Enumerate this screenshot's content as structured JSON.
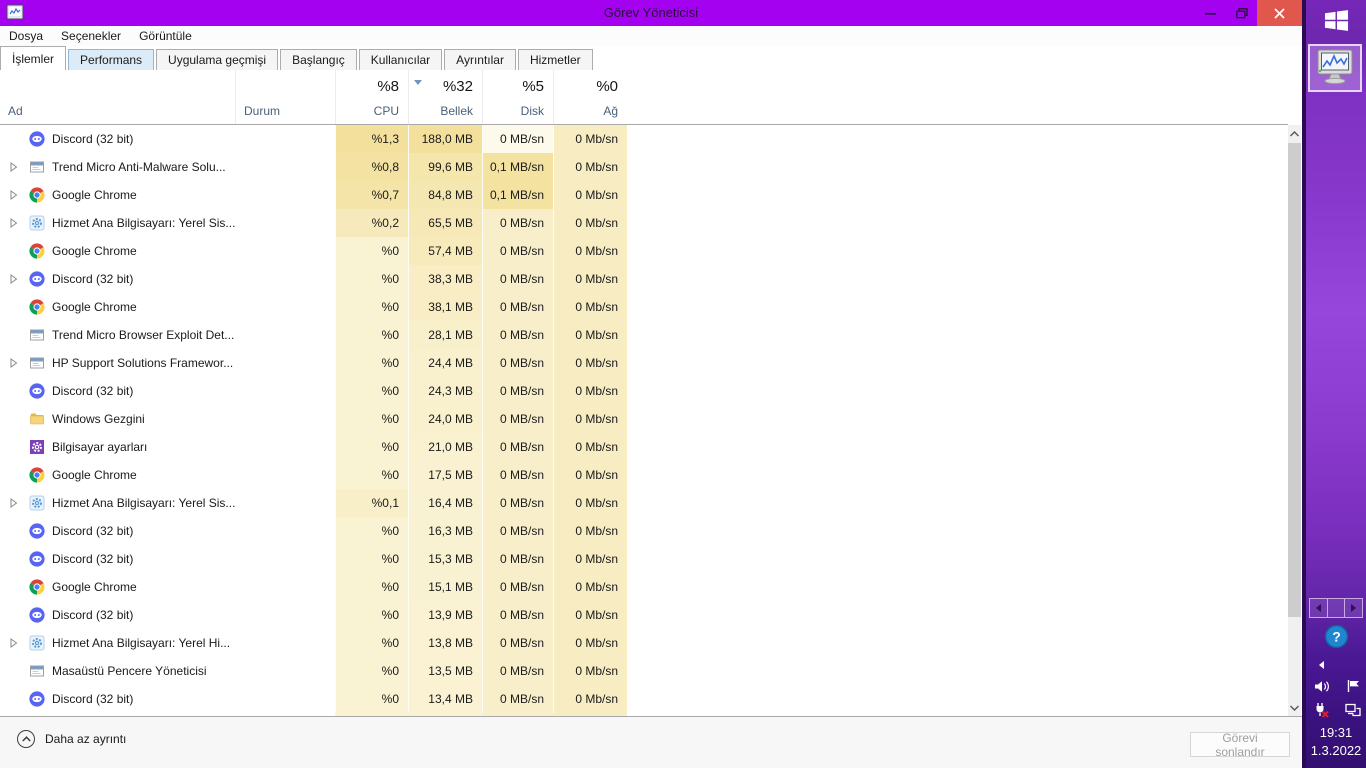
{
  "titlebar": {
    "title": "Görev Yöneticisi"
  },
  "menu": {
    "items": [
      "Dosya",
      "Seçenekler",
      "Görüntüle"
    ]
  },
  "tabs": [
    {
      "label": "İşlemler",
      "state": "selected"
    },
    {
      "label": "Performans",
      "state": "hover"
    },
    {
      "label": "Uygulama geçmişi",
      "state": "normal"
    },
    {
      "label": "Başlangıç",
      "state": "normal"
    },
    {
      "label": "Kullanıcılar",
      "state": "normal"
    },
    {
      "label": "Ayrıntılar",
      "state": "normal"
    },
    {
      "label": "Hizmetler",
      "state": "normal"
    }
  ],
  "header": {
    "name_label": "Ad",
    "status_label": "Durum",
    "cols": [
      {
        "key": "cpu",
        "label": "CPU",
        "total": "%8",
        "sorted": false
      },
      {
        "key": "mem",
        "label": "Bellek",
        "total": "%32",
        "sorted": true
      },
      {
        "key": "disk",
        "label": "Disk",
        "total": "%5",
        "sorted": false
      },
      {
        "key": "net",
        "label": "Ağ",
        "total": "%0",
        "sorted": false
      }
    ]
  },
  "rows": [
    {
      "icon": "discord",
      "name": "Discord (32 bit)",
      "expand": false,
      "status": "",
      "cpu": "%1,3",
      "mem": "188,0 MB",
      "disk": "0 MB/sn",
      "net": "0 Mb/sn",
      "heat": [
        "#f2e09c",
        "#f2e09c",
        "#fdfaeb",
        "#f7ecc2"
      ]
    },
    {
      "icon": "window",
      "name": "Trend Micro Anti-Malware Solu...",
      "expand": true,
      "status": "",
      "cpu": "%0,8",
      "mem": "99,6 MB",
      "disk": "0,1 MB/sn",
      "net": "0 Mb/sn",
      "heat": [
        "#f3e2a2",
        "#f5e6ac",
        "#f3e2a0",
        "#f7ecc2"
      ]
    },
    {
      "icon": "chrome",
      "name": "Google Chrome",
      "expand": true,
      "status": "",
      "cpu": "%0,7",
      "mem": "84,8 MB",
      "disk": "0,1 MB/sn",
      "net": "0 Mb/sn",
      "heat": [
        "#f4e4a7",
        "#f5e7b1",
        "#f3e2a0",
        "#f7ecc2"
      ]
    },
    {
      "icon": "servicehost",
      "name": "Hizmet Ana Bilgisayarı: Yerel Sis...",
      "expand": true,
      "status": "",
      "cpu": "%0,2",
      "mem": "65,5 MB",
      "disk": "0 MB/sn",
      "net": "0 Mb/sn",
      "heat": [
        "#f6eabc",
        "#f6e9b7",
        "#f8efca",
        "#f7ecc2"
      ]
    },
    {
      "icon": "chrome",
      "name": "Google Chrome",
      "expand": false,
      "status": "",
      "cpu": "%0",
      "mem": "57,4 MB",
      "disk": "0 MB/sn",
      "net": "0 Mb/sn",
      "heat": [
        "#f9f2d3",
        "#f7ebbb",
        "#f8efca",
        "#f7ecc2"
      ]
    },
    {
      "icon": "discord",
      "name": "Discord (32 bit)",
      "expand": true,
      "status": "",
      "cpu": "%0",
      "mem": "38,3 MB",
      "disk": "0 MB/sn",
      "net": "0 Mb/sn",
      "heat": [
        "#f9f2d3",
        "#f8edc4",
        "#f8efca",
        "#f7ecc2"
      ]
    },
    {
      "icon": "chrome",
      "name": "Google Chrome",
      "expand": false,
      "status": "",
      "cpu": "%0",
      "mem": "38,1 MB",
      "disk": "0 MB/sn",
      "net": "0 Mb/sn",
      "heat": [
        "#f9f2d3",
        "#f8edc4",
        "#f8efca",
        "#f7ecc2"
      ]
    },
    {
      "icon": "window",
      "name": "Trend Micro Browser Exploit Det...",
      "expand": false,
      "status": "",
      "cpu": "%0",
      "mem": "28,1 MB",
      "disk": "0 MB/sn",
      "net": "0 Mb/sn",
      "heat": [
        "#f9f2d3",
        "#f8efcb",
        "#f8efca",
        "#f7ecc2"
      ]
    },
    {
      "icon": "window",
      "name": "HP Support Solutions Framewor...",
      "expand": true,
      "status": "",
      "cpu": "%0",
      "mem": "24,4 MB",
      "disk": "0 MB/sn",
      "net": "0 Mb/sn",
      "heat": [
        "#f9f2d3",
        "#f9f0cd",
        "#f8efca",
        "#f7ecc2"
      ]
    },
    {
      "icon": "discord",
      "name": "Discord (32 bit)",
      "expand": false,
      "status": "",
      "cpu": "%0",
      "mem": "24,3 MB",
      "disk": "0 MB/sn",
      "net": "0 Mb/sn",
      "heat": [
        "#f9f2d3",
        "#f9f0cd",
        "#f8efca",
        "#f7ecc2"
      ]
    },
    {
      "icon": "folder",
      "name": "Windows Gezgini",
      "expand": false,
      "status": "",
      "cpu": "%0",
      "mem": "24,0 MB",
      "disk": "0 MB/sn",
      "net": "0 Mb/sn",
      "heat": [
        "#f9f2d3",
        "#f9f0cd",
        "#f8efca",
        "#f7ecc2"
      ]
    },
    {
      "icon": "settings",
      "name": "Bilgisayar ayarları",
      "expand": false,
      "status": "",
      "cpu": "%0",
      "mem": "21,0 MB",
      "disk": "0 MB/sn",
      "net": "0 Mb/sn",
      "heat": [
        "#f9f2d3",
        "#f9f1cf",
        "#f8efca",
        "#f7ecc2"
      ]
    },
    {
      "icon": "chrome",
      "name": "Google Chrome",
      "expand": false,
      "status": "",
      "cpu": "%0",
      "mem": "17,5 MB",
      "disk": "0 MB/sn",
      "net": "0 Mb/sn",
      "heat": [
        "#f9f2d3",
        "#f9f1d1",
        "#f8efca",
        "#f7ecc2"
      ]
    },
    {
      "icon": "servicehost",
      "name": "Hizmet Ana Bilgisayarı: Yerel Sis...",
      "expand": true,
      "status": "",
      "cpu": "%0,1",
      "mem": "16,4 MB",
      "disk": "0 MB/sn",
      "net": "0 Mb/sn",
      "heat": [
        "#f8eec8",
        "#f9f2d2",
        "#f8efca",
        "#f7ecc2"
      ]
    },
    {
      "icon": "discord",
      "name": "Discord (32 bit)",
      "expand": false,
      "status": "",
      "cpu": "%0",
      "mem": "16,3 MB",
      "disk": "0 MB/sn",
      "net": "0 Mb/sn",
      "heat": [
        "#f9f2d3",
        "#f9f2d2",
        "#f8efca",
        "#f7ecc2"
      ]
    },
    {
      "icon": "discord",
      "name": "Discord (32 bit)",
      "expand": false,
      "status": "",
      "cpu": "%0",
      "mem": "15,3 MB",
      "disk": "0 MB/sn",
      "net": "0 Mb/sn",
      "heat": [
        "#f9f2d3",
        "#f9f2d2",
        "#f8efca",
        "#f7ecc2"
      ]
    },
    {
      "icon": "chrome",
      "name": "Google Chrome",
      "expand": false,
      "status": "",
      "cpu": "%0",
      "mem": "15,1 MB",
      "disk": "0 MB/sn",
      "net": "0 Mb/sn",
      "heat": [
        "#f9f2d3",
        "#f9f2d2",
        "#f8efca",
        "#f7ecc2"
      ]
    },
    {
      "icon": "discord",
      "name": "Discord (32 bit)",
      "expand": false,
      "status": "",
      "cpu": "%0",
      "mem": "13,9 MB",
      "disk": "0 MB/sn",
      "net": "0 Mb/sn",
      "heat": [
        "#f9f2d3",
        "#faf2d3",
        "#f8efca",
        "#f7ecc2"
      ]
    },
    {
      "icon": "servicehost",
      "name": "Hizmet Ana Bilgisayarı: Yerel Hi...",
      "expand": true,
      "status": "",
      "cpu": "%0",
      "mem": "13,8 MB",
      "disk": "0 MB/sn",
      "net": "0 Mb/sn",
      "heat": [
        "#f9f2d3",
        "#faf2d3",
        "#f8efca",
        "#f7ecc2"
      ]
    },
    {
      "icon": "window",
      "name": "Masaüstü Pencere Yöneticisi",
      "expand": false,
      "status": "",
      "cpu": "%0",
      "mem": "13,5 MB",
      "disk": "0 MB/sn",
      "net": "0 Mb/sn",
      "heat": [
        "#f9f2d3",
        "#faf2d3",
        "#f8efca",
        "#f7ecc2"
      ]
    },
    {
      "icon": "discord",
      "name": "Discord (32 bit)",
      "expand": false,
      "status": "",
      "cpu": "%0",
      "mem": "13,4 MB",
      "disk": "0 MB/sn",
      "net": "0 Mb/sn",
      "heat": [
        "#f9f2d3",
        "#faf2d3",
        "#f8efca",
        "#f7ecc2"
      ]
    }
  ],
  "footer": {
    "toggle_label": "Daha az ayrıntı",
    "end_task_label": "Görevi sonlandır",
    "end_task_enabled": false
  },
  "taskbar": {
    "clock": {
      "time": "19:31",
      "date": "1.3.2022"
    },
    "icons": [
      "windows-start",
      "task-manager",
      "tray-scroll-left",
      "tray-scroll-right",
      "help",
      "show-hidden-icons",
      "volume",
      "action-center-flag",
      "power-disconnected",
      "network"
    ]
  },
  "colors": {
    "titlebar": "#A301F0",
    "close_button": "#E0584D",
    "taskbar_top": "#7627B8",
    "taskbar_bottom": "#330F70",
    "heat_low": "#FAF3D4",
    "heat_high": "#F2E09C",
    "discord": "#5865F2",
    "chrome_blue": "#4285F4"
  }
}
